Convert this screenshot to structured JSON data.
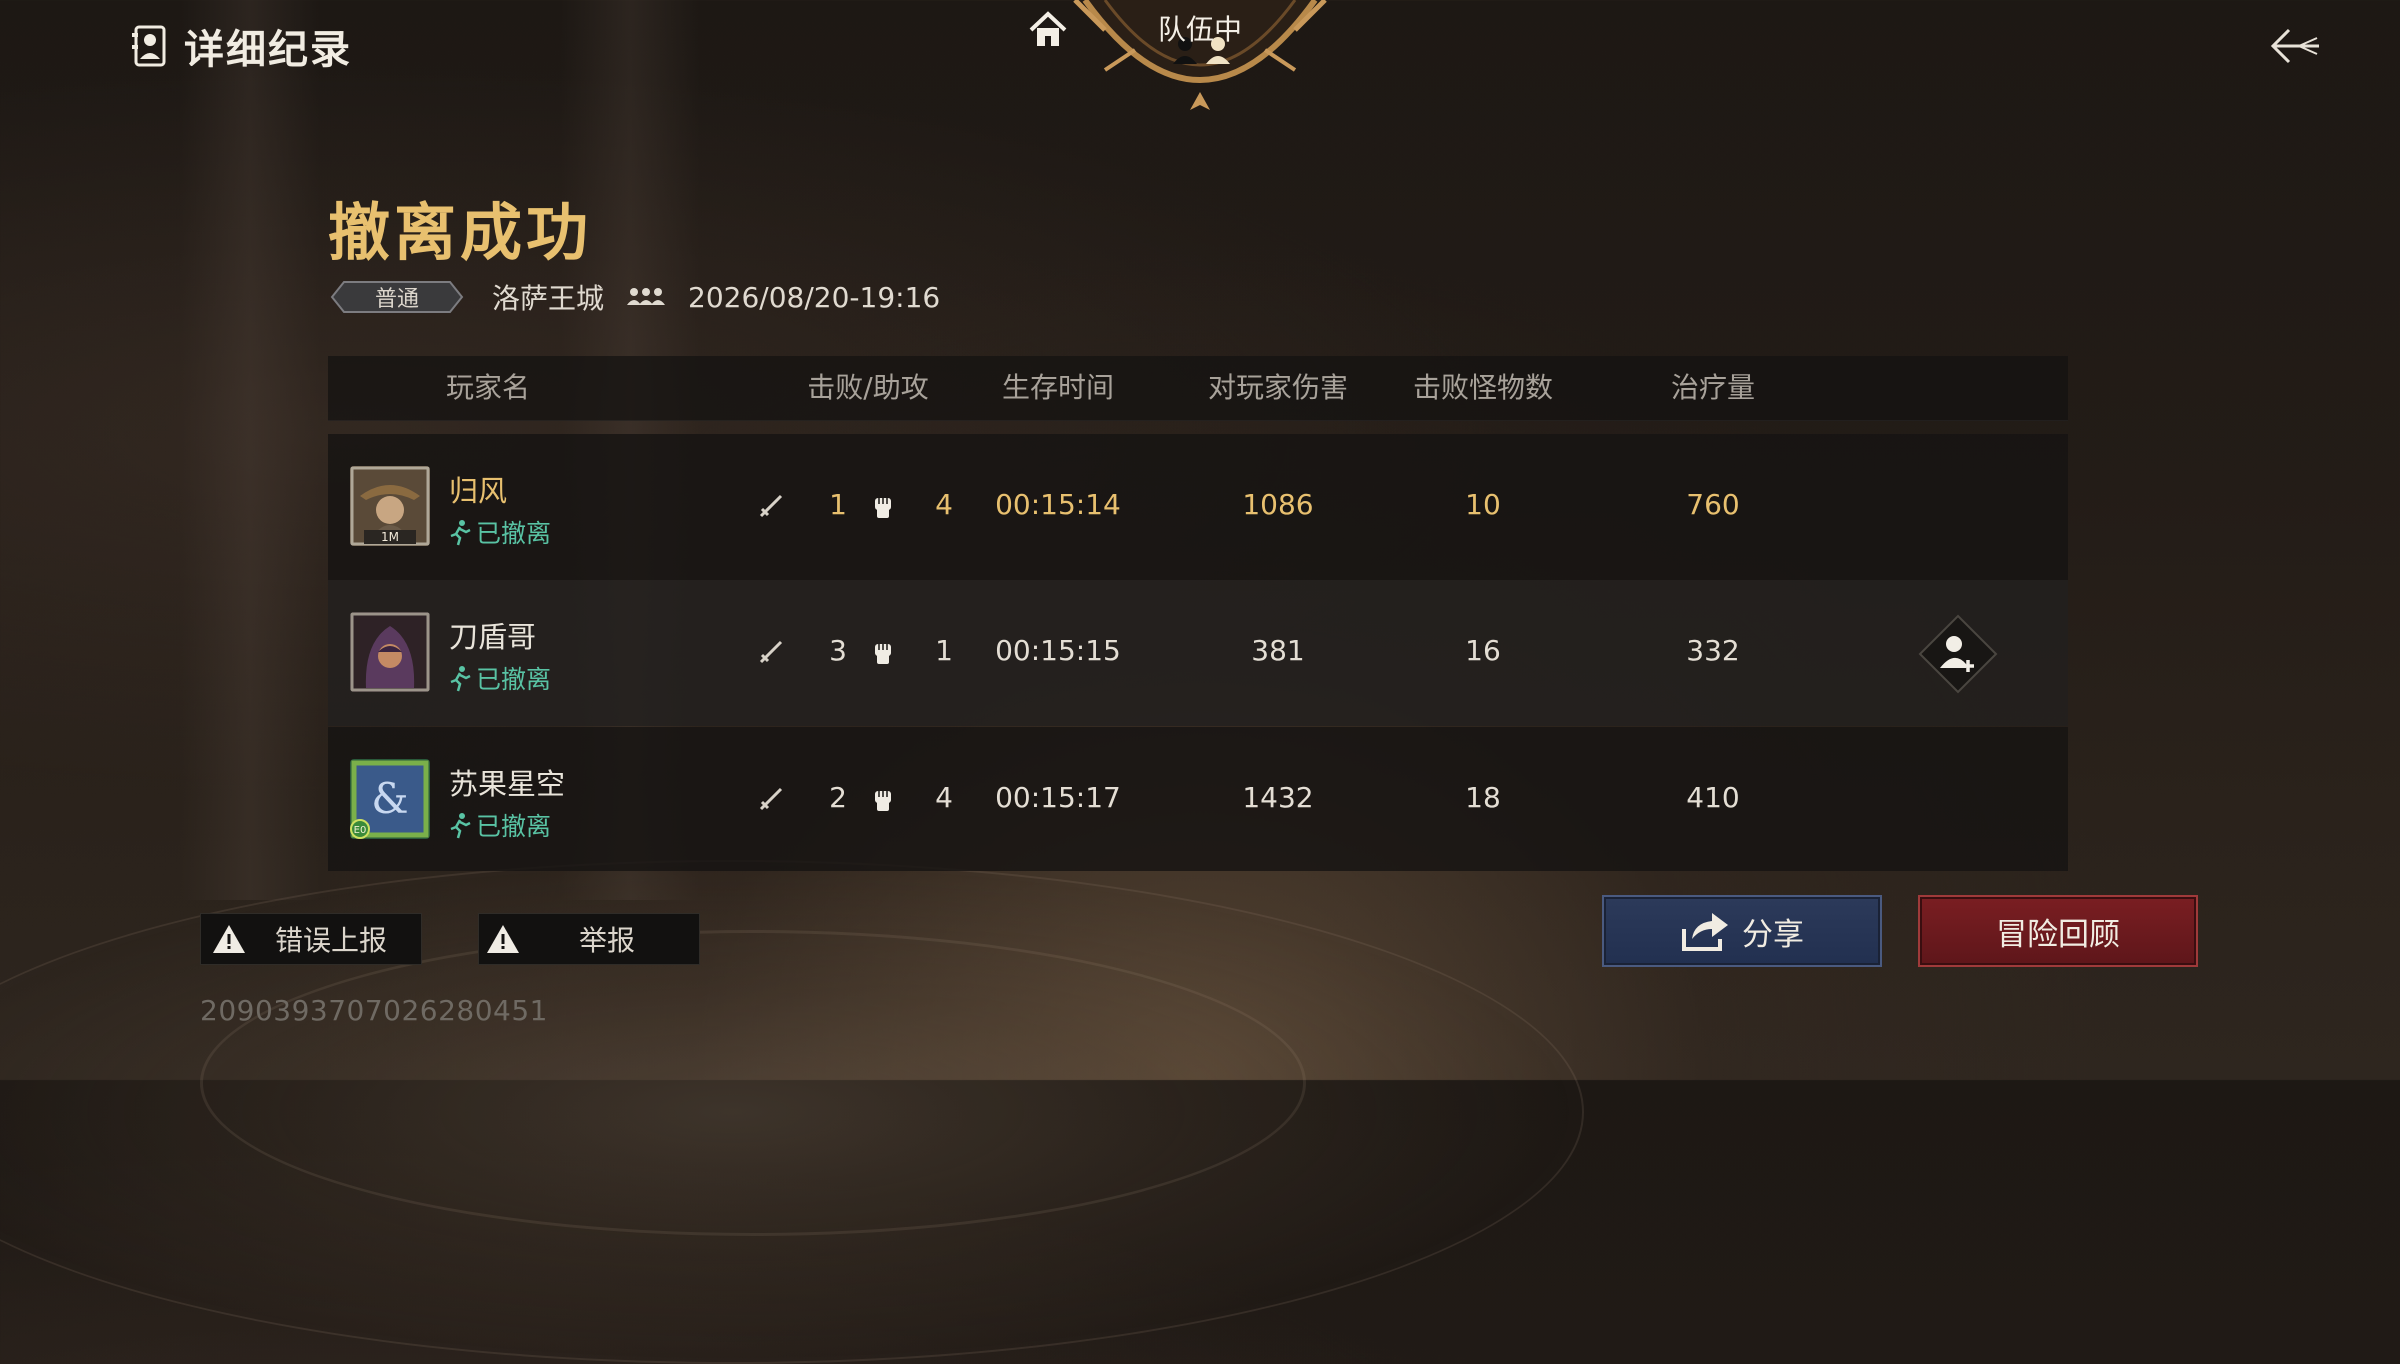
{
  "header": {
    "title": "详细纪录"
  },
  "team": {
    "label": "队伍中"
  },
  "result": {
    "title": "撤离成功",
    "mode": "普通",
    "map": "洛萨王城",
    "datetime": "2026/08/20-19:16"
  },
  "table": {
    "columns": [
      "玩家名",
      "击败/助攻",
      "生存时间",
      "对玩家伤害",
      "击败怪物数",
      "治疗量"
    ],
    "rows": [
      {
        "name": "归风",
        "status": "已撤离",
        "kills": "1",
        "assists": "4",
        "survival": "00:15:14",
        "player_damage": "1086",
        "monsters": "10",
        "healing": "760",
        "avatar_badge": "1M",
        "highlight": true
      },
      {
        "name": "刀盾哥",
        "status": "已撤离",
        "kills": "3",
        "assists": "1",
        "survival": "00:15:15",
        "player_damage": "381",
        "monsters": "16",
        "healing": "332",
        "highlight": false
      },
      {
        "name": "苏果星空",
        "status": "已撤离",
        "kills": "2",
        "assists": "4",
        "survival": "00:15:17",
        "player_damage": "1432",
        "monsters": "18",
        "healing": "410",
        "avatar_badge": "E0",
        "highlight": false
      }
    ]
  },
  "buttons": {
    "error_report": "错误上报",
    "report": "举报",
    "share": "分享",
    "review": "冒险回顾"
  },
  "record_id": "2090393707026280451",
  "colors": {
    "gold": "#e8c06f",
    "status_green": "#59c3a4",
    "share_blue": "#2c3a5a",
    "review_red": "#7a1e22"
  },
  "icons": [
    "journal-icon",
    "home-icon",
    "back-arrow-icon",
    "team-icon",
    "sword-icon",
    "fist-icon",
    "running-icon",
    "add-friend-icon",
    "warning-icon",
    "share-icon"
  ]
}
